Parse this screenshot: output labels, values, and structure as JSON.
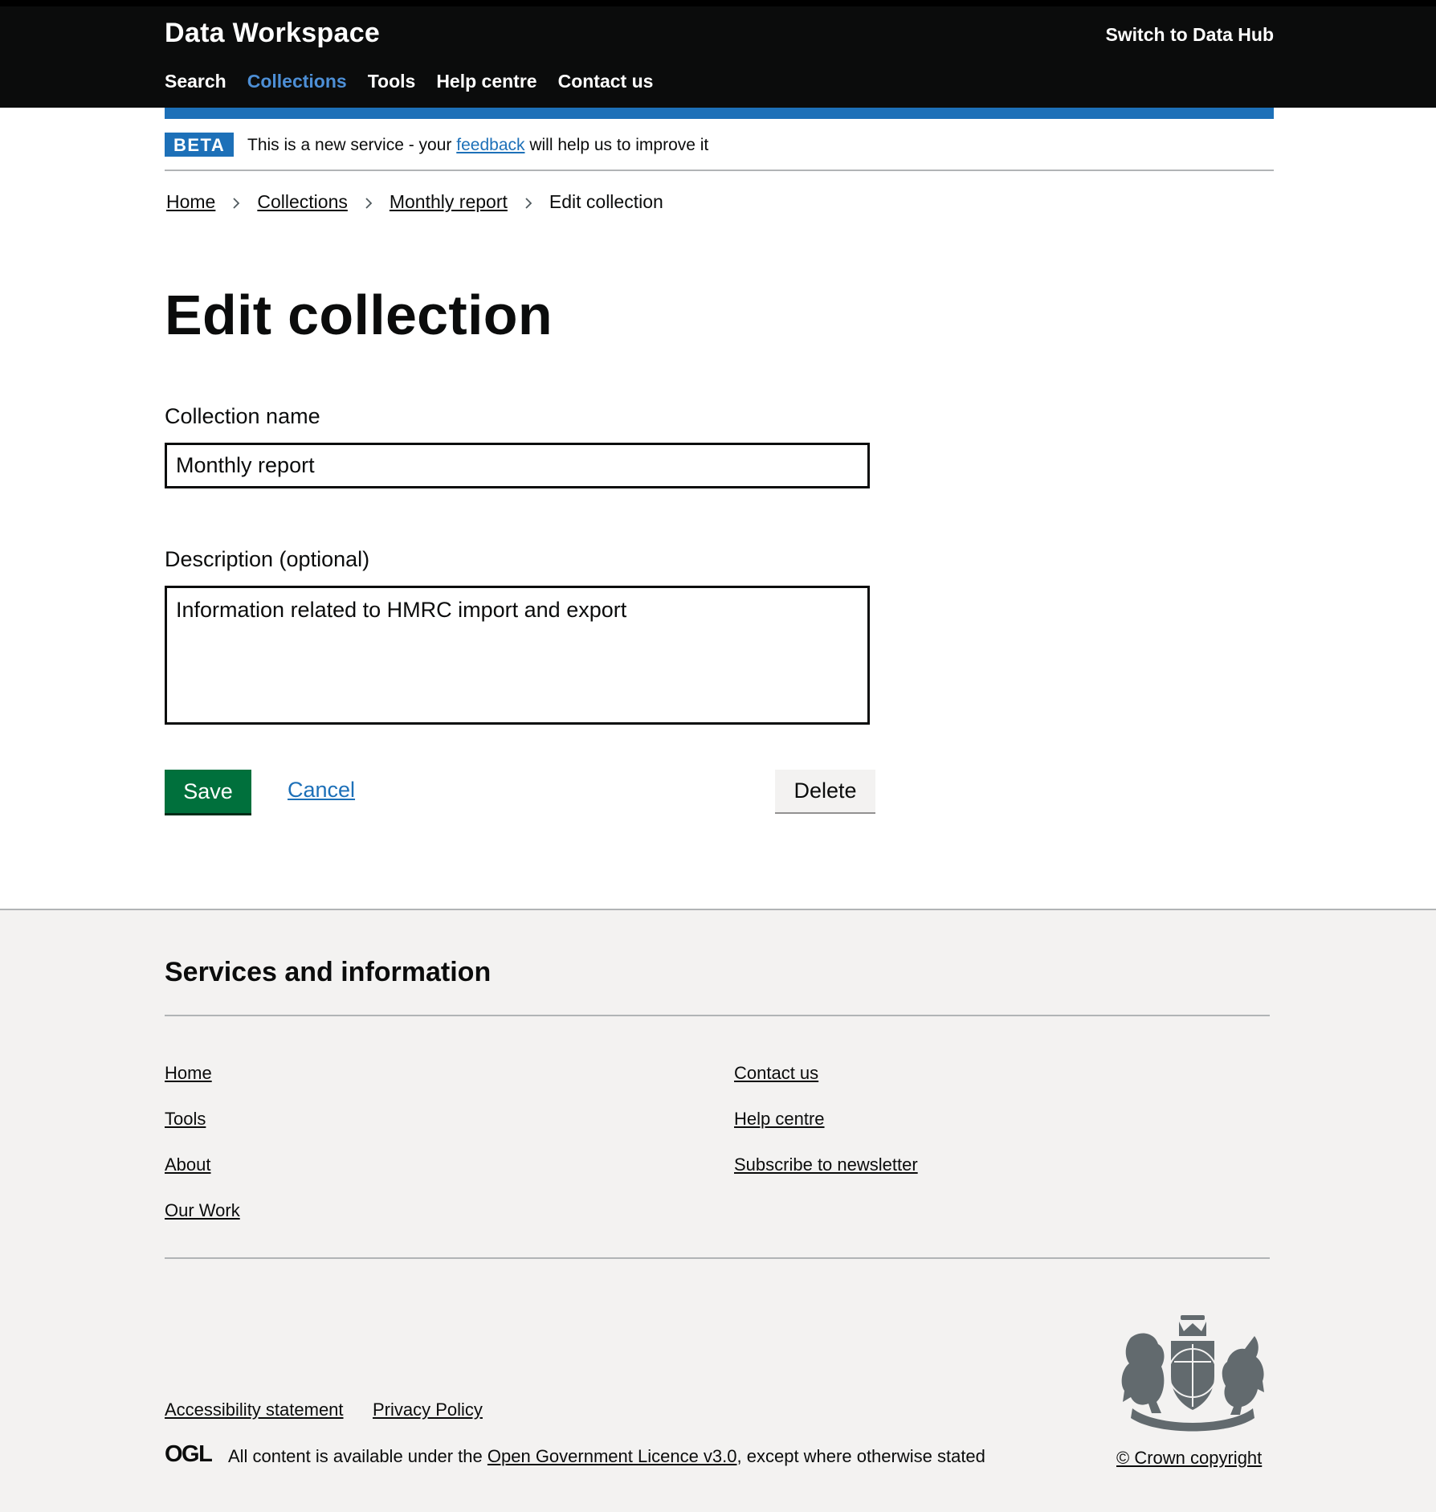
{
  "header": {
    "brand": "Data Workspace",
    "switch_link": "Switch to Data Hub",
    "nav": [
      {
        "label": "Search",
        "active": false
      },
      {
        "label": "Collections",
        "active": true
      },
      {
        "label": "Tools",
        "active": false
      },
      {
        "label": "Help centre",
        "active": false
      },
      {
        "label": "Contact us",
        "active": false
      }
    ]
  },
  "beta": {
    "tag": "BETA",
    "text_before": "This is a new service - your",
    "link": "feedback",
    "text_after": "will help us to improve it"
  },
  "breadcrumb": {
    "items": [
      "Home",
      "Collections",
      "Monthly report"
    ],
    "current": "Edit collection"
  },
  "page_title": "Edit collection",
  "form": {
    "name_label": "Collection name",
    "name_value": "Monthly report",
    "description_label": "Description (optional)",
    "description_value": "Information related to HMRC import and export",
    "save_label": "Save",
    "cancel_label": "Cancel",
    "delete_label": "Delete"
  },
  "footer": {
    "heading": "Services and information",
    "left_links": [
      "Home",
      "Tools",
      "About",
      "Our Work"
    ],
    "right_links": [
      "Contact us",
      "Help centre",
      "Subscribe to newsletter"
    ],
    "meta_links": [
      "Accessibility statement",
      "Privacy Policy"
    ],
    "ogl_before": "All content is available under the",
    "ogl_link": "Open Government Licence v3.0",
    "ogl_after": ", except where otherwise stated",
    "copyright": "© Crown copyright",
    "ogl_logo_text": "OGL"
  },
  "colors": {
    "header_bg": "#0b0c0c",
    "accent_blue": "#1d70b8",
    "active_nav": "#4d8fd6",
    "save_green": "#00703c",
    "footer_bg": "#f3f2f1"
  },
  "icons": [
    "chevron-right-icon",
    "ogl-logo-icon",
    "royal-coat-of-arms-icon"
  ]
}
